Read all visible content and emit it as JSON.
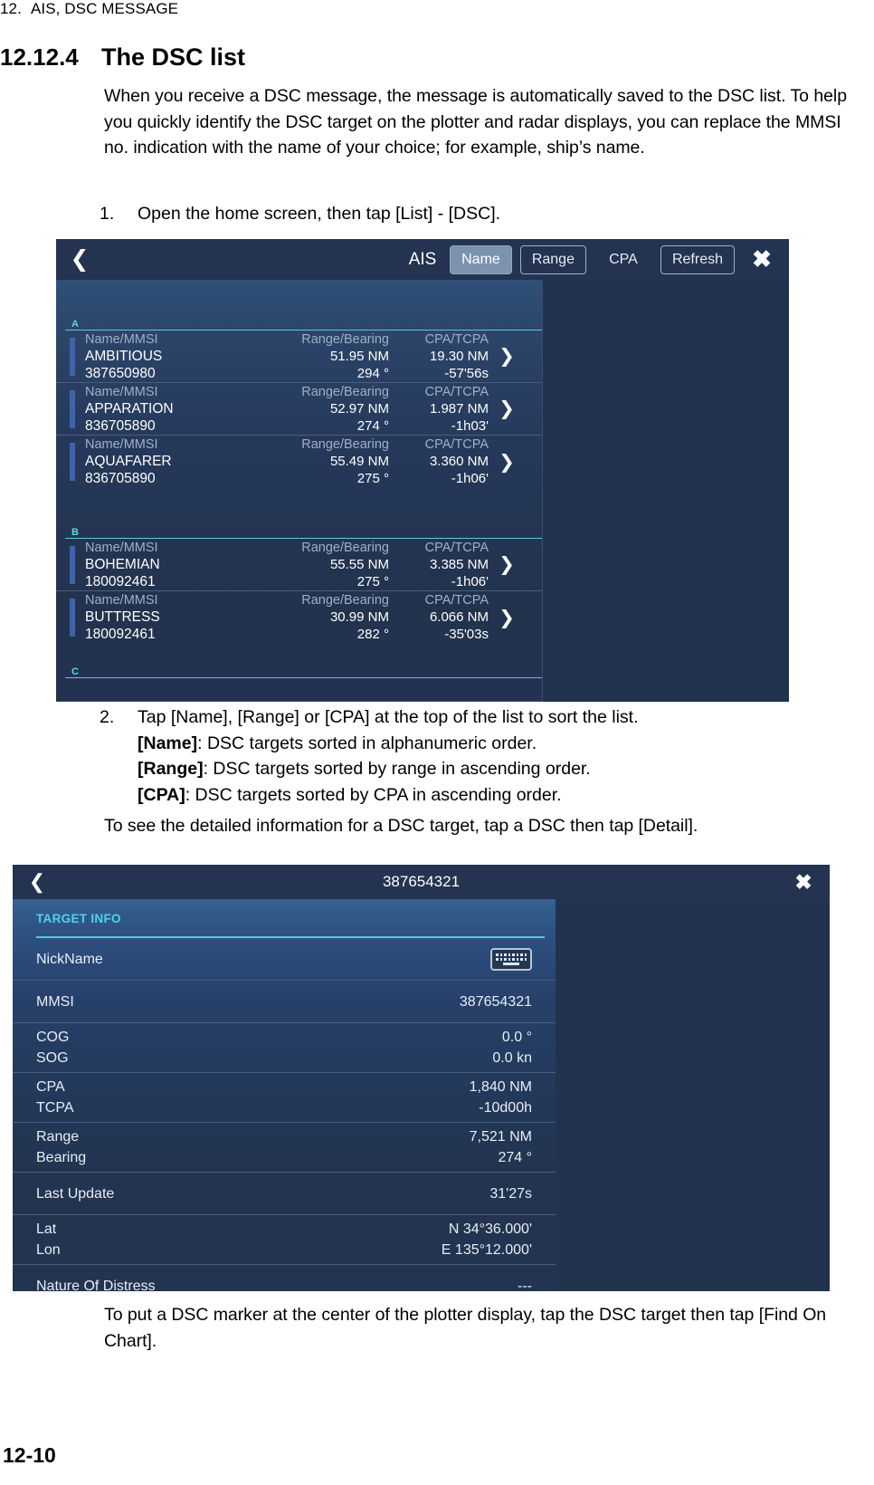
{
  "document": {
    "running_head_chapter": "12.",
    "running_head_title": "AIS, DSC MESSAGE",
    "section_number": "12.12.4",
    "section_title": "The DSC list",
    "intro_paragraph": "When you receive a DSC message, the message is automatically saved to the DSC list. To help you quickly identify the DSC target on the plotter and radar displays, you can replace the MMSI no. indication with the name of your choice; for example, ship’s name.",
    "step1_number": "1.",
    "step1_text": "Open the home screen, then tap [List] - [DSC].",
    "step2_number": "2.",
    "step2_line1": "Tap [Name], [Range] or [CPA] at the top of the list to sort the list.",
    "step2_line2_bold": "[Name]",
    "step2_line2_rest": ": DSC targets sorted in alphanumeric order.",
    "step2_line3_bold": "[Range]",
    "step2_line3_rest": ": DSC targets sorted by range in ascending order.",
    "step2_line4_bold": "[CPA]",
    "step2_line4_rest": ": DSC targets sorted by CPA in ascending order.",
    "note_detail": "To see the detailed information for a DSC target, tap a DSC then tap [Detail].",
    "note_find_on_chart": "To put a DSC marker at the center of the plotter display, tap the DSC target then tap [Find On Chart].",
    "page_number": "12-10"
  },
  "ais_screen": {
    "back_icon": "chevron-left-icon",
    "title": "AIS",
    "close_icon": "close-icon",
    "sort_buttons": [
      {
        "label": "Name",
        "selected": true
      },
      {
        "label": "Range",
        "selected": false
      },
      {
        "label": "CPA",
        "selected": false
      },
      {
        "label": "Refresh",
        "selected": false
      }
    ],
    "column_headers": {
      "name_mmsi": "Name/MMSI",
      "range_bearing": "Range/Bearing",
      "cpa_tcpa": "CPA/TCPA"
    },
    "groups": [
      {
        "letter": "A",
        "rows": [
          {
            "name": "AMBITIOUS",
            "mmsi": "387650980",
            "range": "51.95 NM",
            "bearing": "294 °",
            "cpa": "19.30 NM",
            "tcpa": "-57'56s",
            "chevron": "chevron-right-icon"
          },
          {
            "name": "APPARATION",
            "mmsi": "836705890",
            "range": "52.97 NM",
            "bearing": "274 °",
            "cpa": "1.987 NM",
            "tcpa": "-1h03'",
            "chevron": "chevron-right-icon"
          },
          {
            "name": "AQUAFARER",
            "mmsi": "836705890",
            "range": "55.49 NM",
            "bearing": "275 °",
            "cpa": "3.360 NM",
            "tcpa": "-1h06'",
            "chevron": "chevron-right-icon"
          }
        ]
      },
      {
        "letter": "B",
        "rows": [
          {
            "name": "BOHEMIAN",
            "mmsi": "180092461",
            "range": "55.55 NM",
            "bearing": "275 °",
            "cpa": "3.385 NM",
            "tcpa": "-1h06'",
            "chevron": "chevron-right-icon"
          },
          {
            "name": "BUTTRESS",
            "mmsi": "180092461",
            "range": "30.99 NM",
            "bearing": "282 °",
            "cpa": "6.066 NM",
            "tcpa": "-35'03s",
            "chevron": "chevron-right-icon"
          }
        ]
      },
      {
        "letter": "C",
        "rows": []
      }
    ]
  },
  "detail_screen": {
    "back_icon": "chevron-left-icon",
    "title": "387654321",
    "close_icon": "close-icon",
    "section_label": "TARGET INFO",
    "nickname_label": "NickName",
    "nickname_value": "",
    "keyboard_icon": "keyboard-icon",
    "rows": [
      {
        "label_a": "MMSI",
        "value_a": "387654321"
      },
      {
        "label_a": "COG",
        "value_a": "0.0 °",
        "label_b": "SOG",
        "value_b": "0.0 kn"
      },
      {
        "label_a": "CPA",
        "value_a": "1,840 NM",
        "label_b": "TCPA",
        "value_b": "-10d00h"
      },
      {
        "label_a": "Range",
        "value_a": "7,521 NM",
        "label_b": "Bearing",
        "value_b": "274 °"
      },
      {
        "label_a": "Last Update",
        "value_a": "31'27s"
      },
      {
        "label_a": "Lat",
        "value_a": "N 34°36.000'",
        "label_b": "Lon",
        "value_b": "E 135°12.000'"
      },
      {
        "label_a": "Nature Of Distress",
        "value_a": "---"
      }
    ]
  },
  "colors": {
    "device_bg": "#22334e",
    "titlebar": "#233350",
    "accent_cyan": "#4fc8e3",
    "row_bar_blue": "#3f63ab",
    "selected_button": "#7c93ae"
  }
}
